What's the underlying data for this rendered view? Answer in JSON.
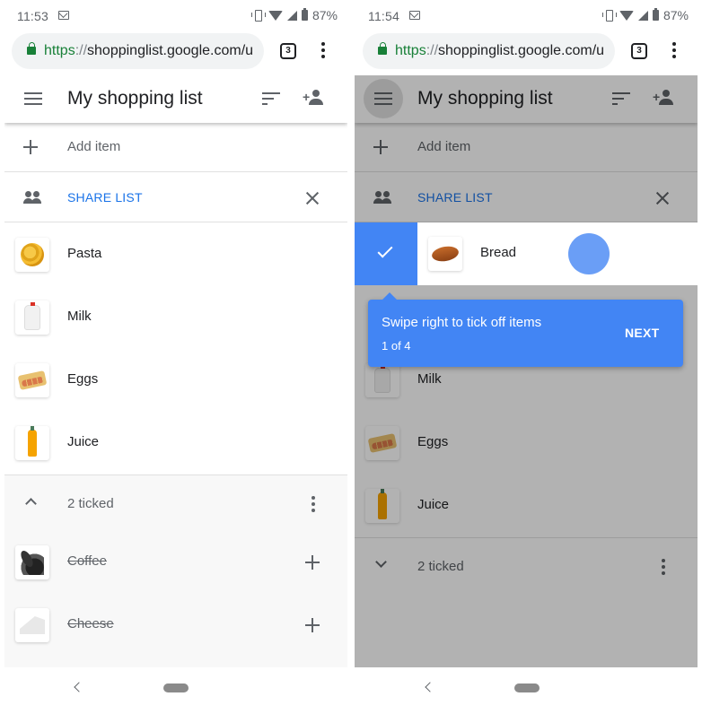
{
  "left": {
    "status": {
      "time": "11:53",
      "battery": "87%"
    },
    "browser": {
      "url_scheme": "https",
      "url_sep": "://",
      "url_rest": "shoppinglist.google.com/u",
      "tab_count": "3"
    },
    "app": {
      "title": "My shopping list",
      "add_item": "Add item",
      "share_list": "SHARE LIST",
      "items": [
        {
          "name": "Pasta",
          "thumb": "pasta"
        },
        {
          "name": "Milk",
          "thumb": "milk"
        },
        {
          "name": "Eggs",
          "thumb": "eggs"
        },
        {
          "name": "Juice",
          "thumb": "juice"
        }
      ],
      "ticked_label": "2 ticked",
      "ticked_expanded": true,
      "ticked_items": [
        {
          "name": "Coffee",
          "thumb": "coffee"
        },
        {
          "name": "Cheese",
          "thumb": "cheese"
        }
      ]
    }
  },
  "right": {
    "status": {
      "time": "11:54",
      "battery": "87%"
    },
    "browser": {
      "url_scheme": "https",
      "url_sep": "://",
      "url_rest": "shoppinglist.google.com/u",
      "tab_count": "3"
    },
    "app": {
      "title": "My shopping list",
      "add_item": "Add item",
      "share_list": "SHARE LIST",
      "swiped_item": {
        "name": "Bread",
        "thumb": "bread"
      },
      "items": [
        {
          "name": "Milk",
          "thumb": "milk"
        },
        {
          "name": "Eggs",
          "thumb": "eggs"
        },
        {
          "name": "Juice",
          "thumb": "juice"
        }
      ],
      "ticked_label": "2 ticked",
      "ticked_expanded": false,
      "tooltip": {
        "text": "Swipe right to tick off items",
        "step": "1 of 4",
        "next_label": "NEXT"
      }
    }
  },
  "colors": {
    "accent_blue": "#4285f4",
    "link_blue": "#1a73e8",
    "secure_green": "#188038"
  }
}
